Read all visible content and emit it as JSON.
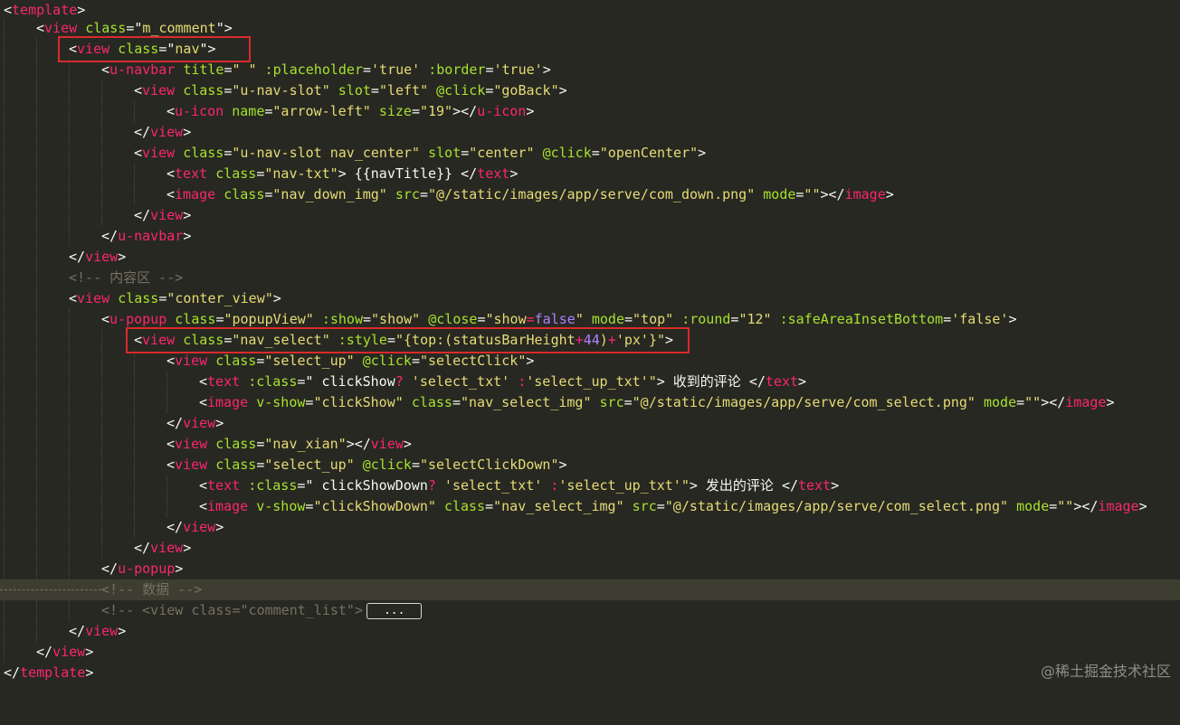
{
  "editor": {
    "lines": {
      "l1_tag": "template",
      "l2_tag": "view",
      "l2_attr": "class",
      "l2_val": "m_comment",
      "l3_tag": "view",
      "l3_attr": "class",
      "l3_val": "nav",
      "l4_tag": "u-navbar",
      "l4_a1": "title",
      "l4_v1": "\" \"",
      "l4_a2": ":placeholder",
      "l4_v2": "'true'",
      "l4_a3": ":border",
      "l4_v3": "'true'",
      "l5_tag": "view",
      "l5_a1": "class",
      "l5_v1": "\"u-nav-slot\"",
      "l5_a2": "slot",
      "l5_v2": "\"left\"",
      "l5_a3": "@click",
      "l5_v3": "\"goBack\"",
      "l6_tag": "u-icon",
      "l6_a1": "name",
      "l6_v1": "\"arrow-left\"",
      "l6_a2": "size",
      "l6_v2": "\"19\"",
      "l6_close": "u-icon",
      "l7_tag": "view",
      "l8_tag": "view",
      "l8_a1": "class",
      "l8_v1": "\"u-nav-slot nav_center\"",
      "l8_a2": "slot",
      "l8_v2": "\"center\"",
      "l8_a3": "@click",
      "l8_v3": "\"openCenter\"",
      "l9_tag": "text",
      "l9_a1": "class",
      "l9_v1": "\"nav-txt\"",
      "l9_txt": " {{navTitle}} ",
      "l9_close": "text",
      "l10_tag": "image",
      "l10_a1": "class",
      "l10_v1": "\"nav_down_img\"",
      "l10_a2": "src",
      "l10_v2": "\"@/static/images/app/serve/com_down.png\"",
      "l10_a3": "mode",
      "l10_v3": "\"\"",
      "l10_close": "image",
      "l11_tag": "view",
      "l12_tag": "u-navbar",
      "l13_tag": "view",
      "l14_com": "<!-- 内容区 -->",
      "l15_tag": "view",
      "l15_a1": "class",
      "l15_v1": "\"conter_view\"",
      "l16_tag": "u-popup",
      "l16_a1": "class",
      "l16_v1": "\"popupView\"",
      "l16_a2": ":show",
      "l16_v2": "\"show\"",
      "l16_a3": "@close",
      "l16_v3a": "\"show",
      "l16_v3op": "=",
      "l16_v3b": "false",
      "l16_v3c": "\"",
      "l16_a4": "mode",
      "l16_v4": "\"top\"",
      "l16_a5": ":round",
      "l16_v5": "\"12\"",
      "l16_a6": ":safeAreaInsetBottom",
      "l16_v6": "'false'",
      "l17_tag": "view",
      "l17_a1": "class",
      "l17_v1": "\"nav_select\"",
      "l17_a2": ":style",
      "l17_v2a": "\"{top:(statusBarHeight",
      "l17_v2op": "+",
      "l17_v2n": "44",
      "l17_v2b": ")",
      "l17_v2op2": "+",
      "l17_v2c": "'px'}\"",
      "l18_tag": "view",
      "l18_a1": "class",
      "l18_v1": "\"select_up\"",
      "l18_a2": "@click",
      "l18_v2": "\"selectClick\"",
      "l19_tag": "text",
      "l19_a1": ":class",
      "l19_v1a": "\" clickShow",
      "l19_v1op": "?",
      "l19_v1b": " 'select_txt' ",
      "l19_v1op2": ":",
      "l19_v1c": "'select_up_txt'\"",
      "l19_txt": " 收到的评论 ",
      "l19_close": "text",
      "l20_tag": "image",
      "l20_a1": "v-show",
      "l20_v1": "\"clickShow\"",
      "l20_a2": "class",
      "l20_v2": "\"nav_select_img\"",
      "l20_a3": "src",
      "l20_v3": "\"@/static/images/app/serve/com_select.png\"",
      "l20_a4": "mode",
      "l20_v4": "\"\"",
      "l20_close": "image",
      "l21_tag": "view",
      "l22_tag": "view",
      "l22_a1": "class",
      "l22_v1": "\"nav_xian\"",
      "l22_close": "view",
      "l23_tag": "view",
      "l23_a1": "class",
      "l23_v1": "\"select_up\"",
      "l23_a2": "@click",
      "l23_v2": "\"selectClickDown\"",
      "l24_tag": "text",
      "l24_a1": ":class",
      "l24_v1a": "\" clickShowDown",
      "l24_v1op": "?",
      "l24_v1b": " 'select_txt' ",
      "l24_v1op2": ":",
      "l24_v1c": "'select_up_txt'\"",
      "l24_txt": " 发出的评论 ",
      "l24_close": "text",
      "l25_tag": "image",
      "l25_a1": "v-show",
      "l25_v1": "\"clickShowDown\"",
      "l25_a2": "class",
      "l25_v2": "\"nav_select_img\"",
      "l25_a3": "src",
      "l25_v3": "\"@/static/images/app/serve/com_select.png\"",
      "l25_a4": "mode",
      "l25_v4": "\"\"",
      "l25_close": "image",
      "l26_tag": "view",
      "l27_tag": "view",
      "l28_tag": "u-popup",
      "l29_com": "<!-- 数据 -->",
      "l30_com": "<!-- <view class=\"comment_list\">",
      "l30_fold": "...",
      "l31_tag": "view",
      "l32_tag": "view",
      "l33_tag": "template"
    }
  },
  "watermark": "@稀土掘金技术社区"
}
